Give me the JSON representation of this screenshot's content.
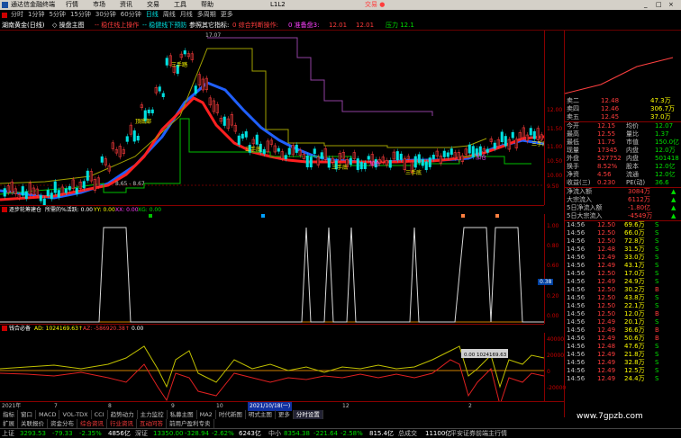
{
  "app": {
    "title": "通达信金融终端",
    "menu": [
      "行情",
      "市场",
      "资讯",
      "交易",
      "工具",
      "帮助"
    ],
    "window_label": "L1L2",
    "trade_label": "交易 ●",
    "win_btns": [
      "_",
      "□",
      "×"
    ]
  },
  "periods": [
    "分时",
    "1分钟",
    "5分钟",
    "15分钟",
    "30分钟",
    "60分钟",
    "日线",
    "周线",
    "月线",
    "多周期",
    "更多"
  ],
  "top_infobar": {
    "name": "湖南黄金(日线)",
    "i1": "◇ 操盘主图",
    "i2": "-- 稳住线上操作",
    "i3": "-- 稳健线下预防",
    "i4": "参照其它指标:",
    "i5": "0 综合判断操作:",
    "i6": "0 准备盘3:",
    "i7": "12.01",
    "i8": "12.01",
    "i9": "压力 12.1"
  },
  "price_axis": [
    "12.00",
    "11.50",
    "11.00",
    "10.50",
    "10.00",
    "9.50"
  ],
  "price_marks": {
    "high": "17.07",
    "low": "8.65 - 8.67"
  },
  "labels_main": {
    "a": "三手踏",
    "b": "顶底部",
    "c": "三手底",
    "d": "三手底",
    "e": "加仓",
    "f": "三手底",
    "g": "三手底",
    "h": "加仓"
  },
  "ind1": {
    "title": "逐步轮筹建仓",
    "legend": "所需的%活跃: 0.00",
    "yy": "YY: 0.00",
    "xx": "XX: 0.00",
    "xg": "XG: 0.00",
    "axis": [
      "1.00",
      "0.80",
      "0.60",
      "0.38",
      "0.20",
      "0.00"
    ],
    "cur": "0.38"
  },
  "ind2": {
    "title": "钱合必备",
    "ad": "AD: 1024169.63↑",
    "az": "AZ: -586920.38↑",
    "v3": "0.00",
    "axis": [
      "40000",
      "20000",
      "0",
      "-20000"
    ],
    "tooltip": "0.00 1024169.63"
  },
  "dates": [
    "2021年",
    "7",
    "8",
    "9",
    "10",
    "2021/10/18(一)",
    "12",
    "2"
  ],
  "rightpanel": {
    "quotes": [
      [
        "卖二",
        "12.48",
        "47.3万"
      ],
      [
        "卖四",
        "12.46",
        "306.7万"
      ],
      [
        "卖五",
        "12.45",
        "37.0万"
      ]
    ],
    "stats": [
      [
        "今开",
        "12.15",
        "均价",
        "12.07"
      ],
      [
        "最高",
        "12.55",
        "量比",
        "1.37"
      ],
      [
        "最低",
        "11.75",
        "市值",
        "150.0亿"
      ],
      [
        "现量",
        "17345",
        "内盘",
        "12.0万"
      ],
      [
        "外盘",
        "527752",
        "内盘",
        "501418"
      ],
      [
        "换手",
        "8.52%",
        "股本",
        "12.0亿"
      ],
      [
        "净资",
        "4.56",
        "流通",
        "12.0亿"
      ],
      [
        "收益(三)",
        "0.230",
        "PE(动)",
        "36.6"
      ]
    ],
    "flow": [
      [
        "净流入额",
        "3084万",
        "▲"
      ],
      [
        "大宗流入",
        "6112万",
        "▲"
      ],
      [
        "5日净流入额",
        "-1.80亿",
        "▲"
      ],
      [
        "5日大宗流入",
        "-4549万",
        "▲"
      ]
    ],
    "ticks": [
      [
        "14:56",
        "12.50",
        "69.6万",
        "S"
      ],
      [
        "14:56",
        "12.50",
        "66.0万",
        "S"
      ],
      [
        "14:56",
        "12.50",
        "72.8万",
        "S"
      ],
      [
        "14:56",
        "12.48",
        "31.5万",
        "S"
      ],
      [
        "14:56",
        "12.49",
        "33.0万",
        "S"
      ],
      [
        "14:56",
        "12.49",
        "43.1万",
        "S"
      ],
      [
        "14:56",
        "12.50",
        "17.0万",
        "S"
      ],
      [
        "14:56",
        "12.49",
        "24.9万",
        "S"
      ],
      [
        "14:56",
        "12.50",
        "30.2万",
        "B"
      ],
      [
        "14:56",
        "12.50",
        "43.8万",
        "S"
      ],
      [
        "14:56",
        "12.50",
        "22.1万",
        "S"
      ],
      [
        "14:56",
        "12.50",
        "12.0万",
        "B"
      ],
      [
        "14:56",
        "12.49",
        "20.1万",
        "S"
      ],
      [
        "14:56",
        "12.49",
        "36.6万",
        "B"
      ],
      [
        "14:56",
        "12.49",
        "50.6万",
        "B"
      ],
      [
        "14:56",
        "12.48",
        "47.6万",
        "S"
      ],
      [
        "14:56",
        "12.49",
        "21.8万",
        "S"
      ],
      [
        "14:56",
        "12.49",
        "32.8万",
        "S"
      ],
      [
        "14:56",
        "12.49",
        "12.5万",
        "S"
      ],
      [
        "14:56",
        "12.49",
        "24.4万",
        "S"
      ]
    ]
  },
  "bottom_tabs": [
    "指标",
    "窗口",
    "MACD",
    "VOL-TDX",
    "CCI",
    "趋势动力",
    "主力监控",
    "私募主图",
    "MA2",
    "时代新图",
    "明式主图",
    "更多",
    "分时设置"
  ],
  "side_tabs": [
    "扩展",
    "关联报价",
    "资金分布",
    "综合资讯",
    "行业资讯",
    "互动问答",
    "前用户盈利专卖"
  ],
  "status": {
    "sh": "上证",
    "sh_v": "3293.53",
    "sh_c": "-79.33",
    "sh_p": "-2.35%",
    "sh_a": "4856亿",
    "sz": "深证",
    "sz_v": "13350.00",
    "sz_c": "-328.94",
    "sz_p": "-2.62%",
    "sz_a": "6243亿",
    "zx": "中小",
    "zx_v": "8354.38",
    "zx_c": "-221.64",
    "zx_p": "-2.58%",
    "zx_a": "815.4亿",
    "news": "总成交",
    "news_v": "11100亿",
    "broker": "平安证券前端主行情"
  },
  "watermark": "www.7gpzb.com",
  "colors": {
    "up": "#ff3c3c",
    "down": "#00e0e0",
    "ma_blue": "#2060ff",
    "bg": "#000000"
  }
}
